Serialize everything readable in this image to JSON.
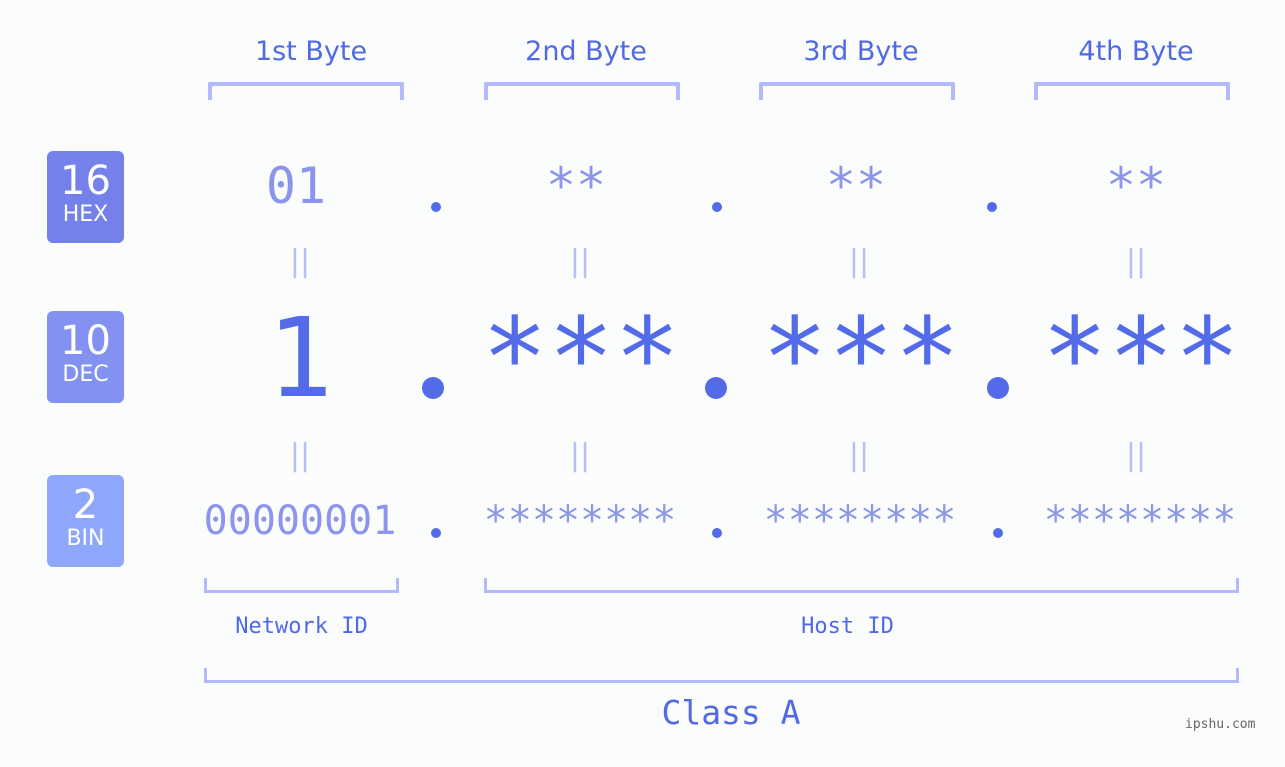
{
  "bytes": [
    {
      "label": "1st Byte",
      "hex": "01",
      "dec": "1",
      "bin": "00000001"
    },
    {
      "label": "2nd Byte",
      "hex": "**",
      "dec": "***",
      "bin": "********"
    },
    {
      "label": "3rd Byte",
      "hex": "**",
      "dec": "***",
      "bin": "********"
    },
    {
      "label": "4th Byte",
      "hex": "**",
      "dec": "***",
      "bin": "********"
    }
  ],
  "bases": [
    {
      "number": "16",
      "unit": "HEX",
      "color": "#7481ea"
    },
    {
      "number": "10",
      "unit": "DEC",
      "color": "#8391f0"
    },
    {
      "number": "2",
      "unit": "BIN",
      "color": "#8ea7fa"
    }
  ],
  "equals_symbol": "||",
  "network_id_label": "Network ID",
  "host_id_label": "Host ID",
  "class_label": "Class A",
  "watermark": "ipshu.com",
  "colors": {
    "accent": "#546be9",
    "text": "#5069e4",
    "light": "#8b95ee",
    "bracket": "#b3baf9"
  }
}
